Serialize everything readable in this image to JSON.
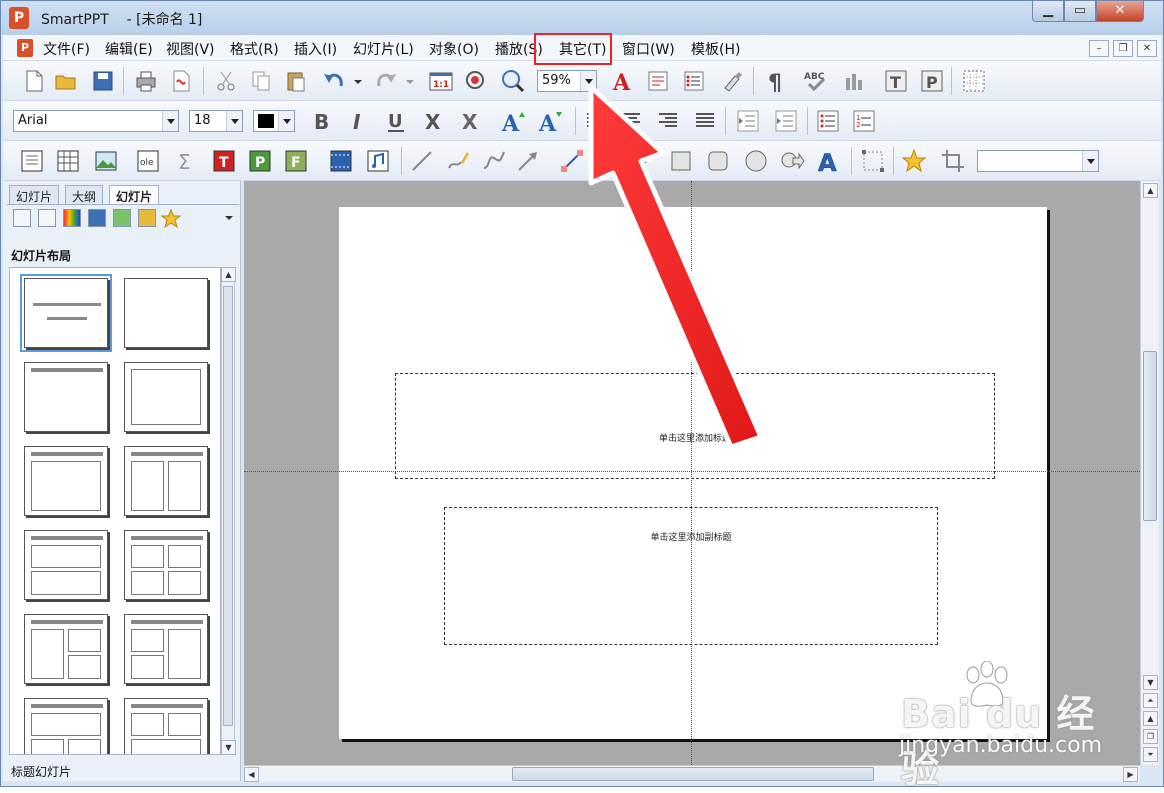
{
  "window": {
    "app_name": "SmartPPT",
    "doc_title": "- [未命名 1]",
    "min_label": "▁",
    "max_label": "▭",
    "close_label": "✕"
  },
  "menu": {
    "items": [
      "文件(F)",
      "编辑(E)",
      "视图(V)",
      "格式(R)",
      "插入(I)",
      "幻灯片(L)",
      "对象(O)",
      "播放(S)",
      "其它(T)",
      "窗口(W)",
      "模板(H)"
    ],
    "highlighted": "其它(T)",
    "mdi_min": "–",
    "mdi_restore": "❐",
    "mdi_close": "✕"
  },
  "toolbar": {
    "zoom_value": "59%",
    "font_name": "Arial",
    "font_size": "18",
    "accent_color": "#e8232a"
  },
  "left_panel": {
    "tabs": [
      "幻灯片",
      "大纲",
      "幻灯片"
    ],
    "section_title": "幻灯片布局",
    "status_text": "标题幻灯片"
  },
  "slide": {
    "title_placeholder": "单击这里添加标题",
    "subtitle_placeholder": "单击这里添加副标题"
  },
  "watermark": {
    "brand": "Bai du 经验",
    "url": "jingyan.baidu.com"
  }
}
